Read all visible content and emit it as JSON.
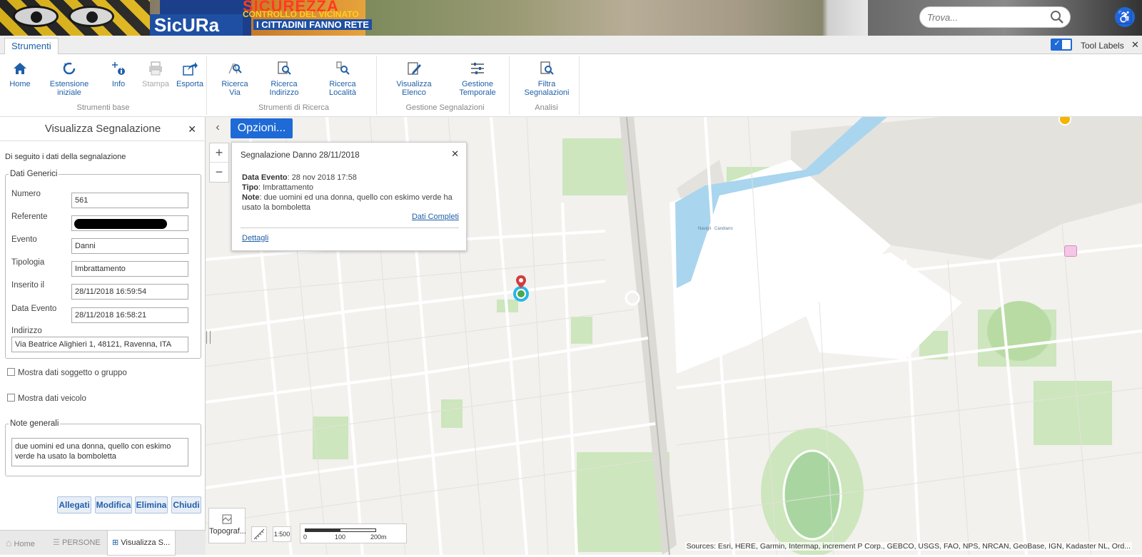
{
  "banner": {
    "brand": "SicURa",
    "line1": "SICUREZZA",
    "line2": "CONTROLLO DEL VICINATO",
    "line3": "I CITTADINI FANNO RETE",
    "search_placeholder": "Trova..."
  },
  "tabs": {
    "active": "Strumenti",
    "tool_labels": "Tool Labels"
  },
  "ribbon": {
    "groups": [
      {
        "label": "Strumenti base",
        "tools": [
          "Home",
          "Estensione iniziale",
          "Info",
          "Stampa",
          "Esporta"
        ]
      },
      {
        "label": "Strumenti di Ricerca",
        "tools": [
          "Ricerca Via",
          "Ricerca Indirizzo",
          "Ricerca Località"
        ]
      },
      {
        "label": "Gestione Segnalazioni",
        "tools": [
          "Visualizza Elenco",
          "Gestione Temporale"
        ]
      },
      {
        "label": "Analisi",
        "tools": [
          "Filtra Segnalazioni"
        ]
      }
    ]
  },
  "panel": {
    "title": "Visualizza Segnalazione",
    "intro": "Di seguito i dati della segnalazione",
    "section_generic": "Dati Generici",
    "fields": {
      "numero_label": "Numero",
      "numero": "561",
      "referente_label": "Referente",
      "evento_label": "Evento",
      "evento": "Danni",
      "tipologia_label": "Tipologia",
      "tipologia": "Imbrattamento",
      "inserito_label": "Inserito il",
      "inserito": "28/11/2018 16:59:54",
      "data_evento_label": "Data Evento",
      "data_evento": "28/11/2018 16:58:21",
      "indirizzo_label": "Indirizzo",
      "indirizzo": "Via Beatrice Alighieri 1, 48121, Ravenna, ITA"
    },
    "check_soggetto": "Mostra dati soggetto o gruppo",
    "check_veicolo": "Mostra dati veicolo",
    "section_note": "Note generali",
    "note": "due uomini ed una donna, quello con eskimo verde ha usato la bomboletta",
    "buttons": {
      "allegati": "Allegati",
      "modifica": "Modifica",
      "elimina": "Elimina",
      "chiudi": "Chiudi"
    }
  },
  "bottom_tabs": [
    "Home",
    "PERSONE",
    "Visualizza S..."
  ],
  "map": {
    "opzioni": "Opzioni...",
    "popup": {
      "title": "Segnalazione Danno 28/11/2018",
      "data_evento_label": "Data Evento",
      "data_evento": ": 28 nov 2018 17:58",
      "tipo_label": "Tipo",
      "tipo": ": Imbrattamento",
      "note_label": "Note",
      "note": ": due uomini ed una donna, quello con eskimo verde ha usato la bomboletta",
      "dati_completi": "Dati Completi",
      "dettagli": "Dettagli"
    },
    "basemap_label": "Topograf...",
    "scale_ratio": "1:500",
    "scale_labels": [
      "0",
      "100",
      "200m"
    ],
    "water_label": "Naviglio Candiano",
    "attribution": "Sources: Esri, HERE, Garmin, Intermap, increment P Corp., GEBCO, USGS, FAO, NPS, NRCAN, GeoBase, IGN, Kadaster NL, Ord..."
  },
  "colors": {
    "accent": "#1e6ad6",
    "link": "#1f5fa8",
    "water": "#a9d5ef",
    "park": "#cde6bd",
    "marker": "#d23c3c"
  }
}
